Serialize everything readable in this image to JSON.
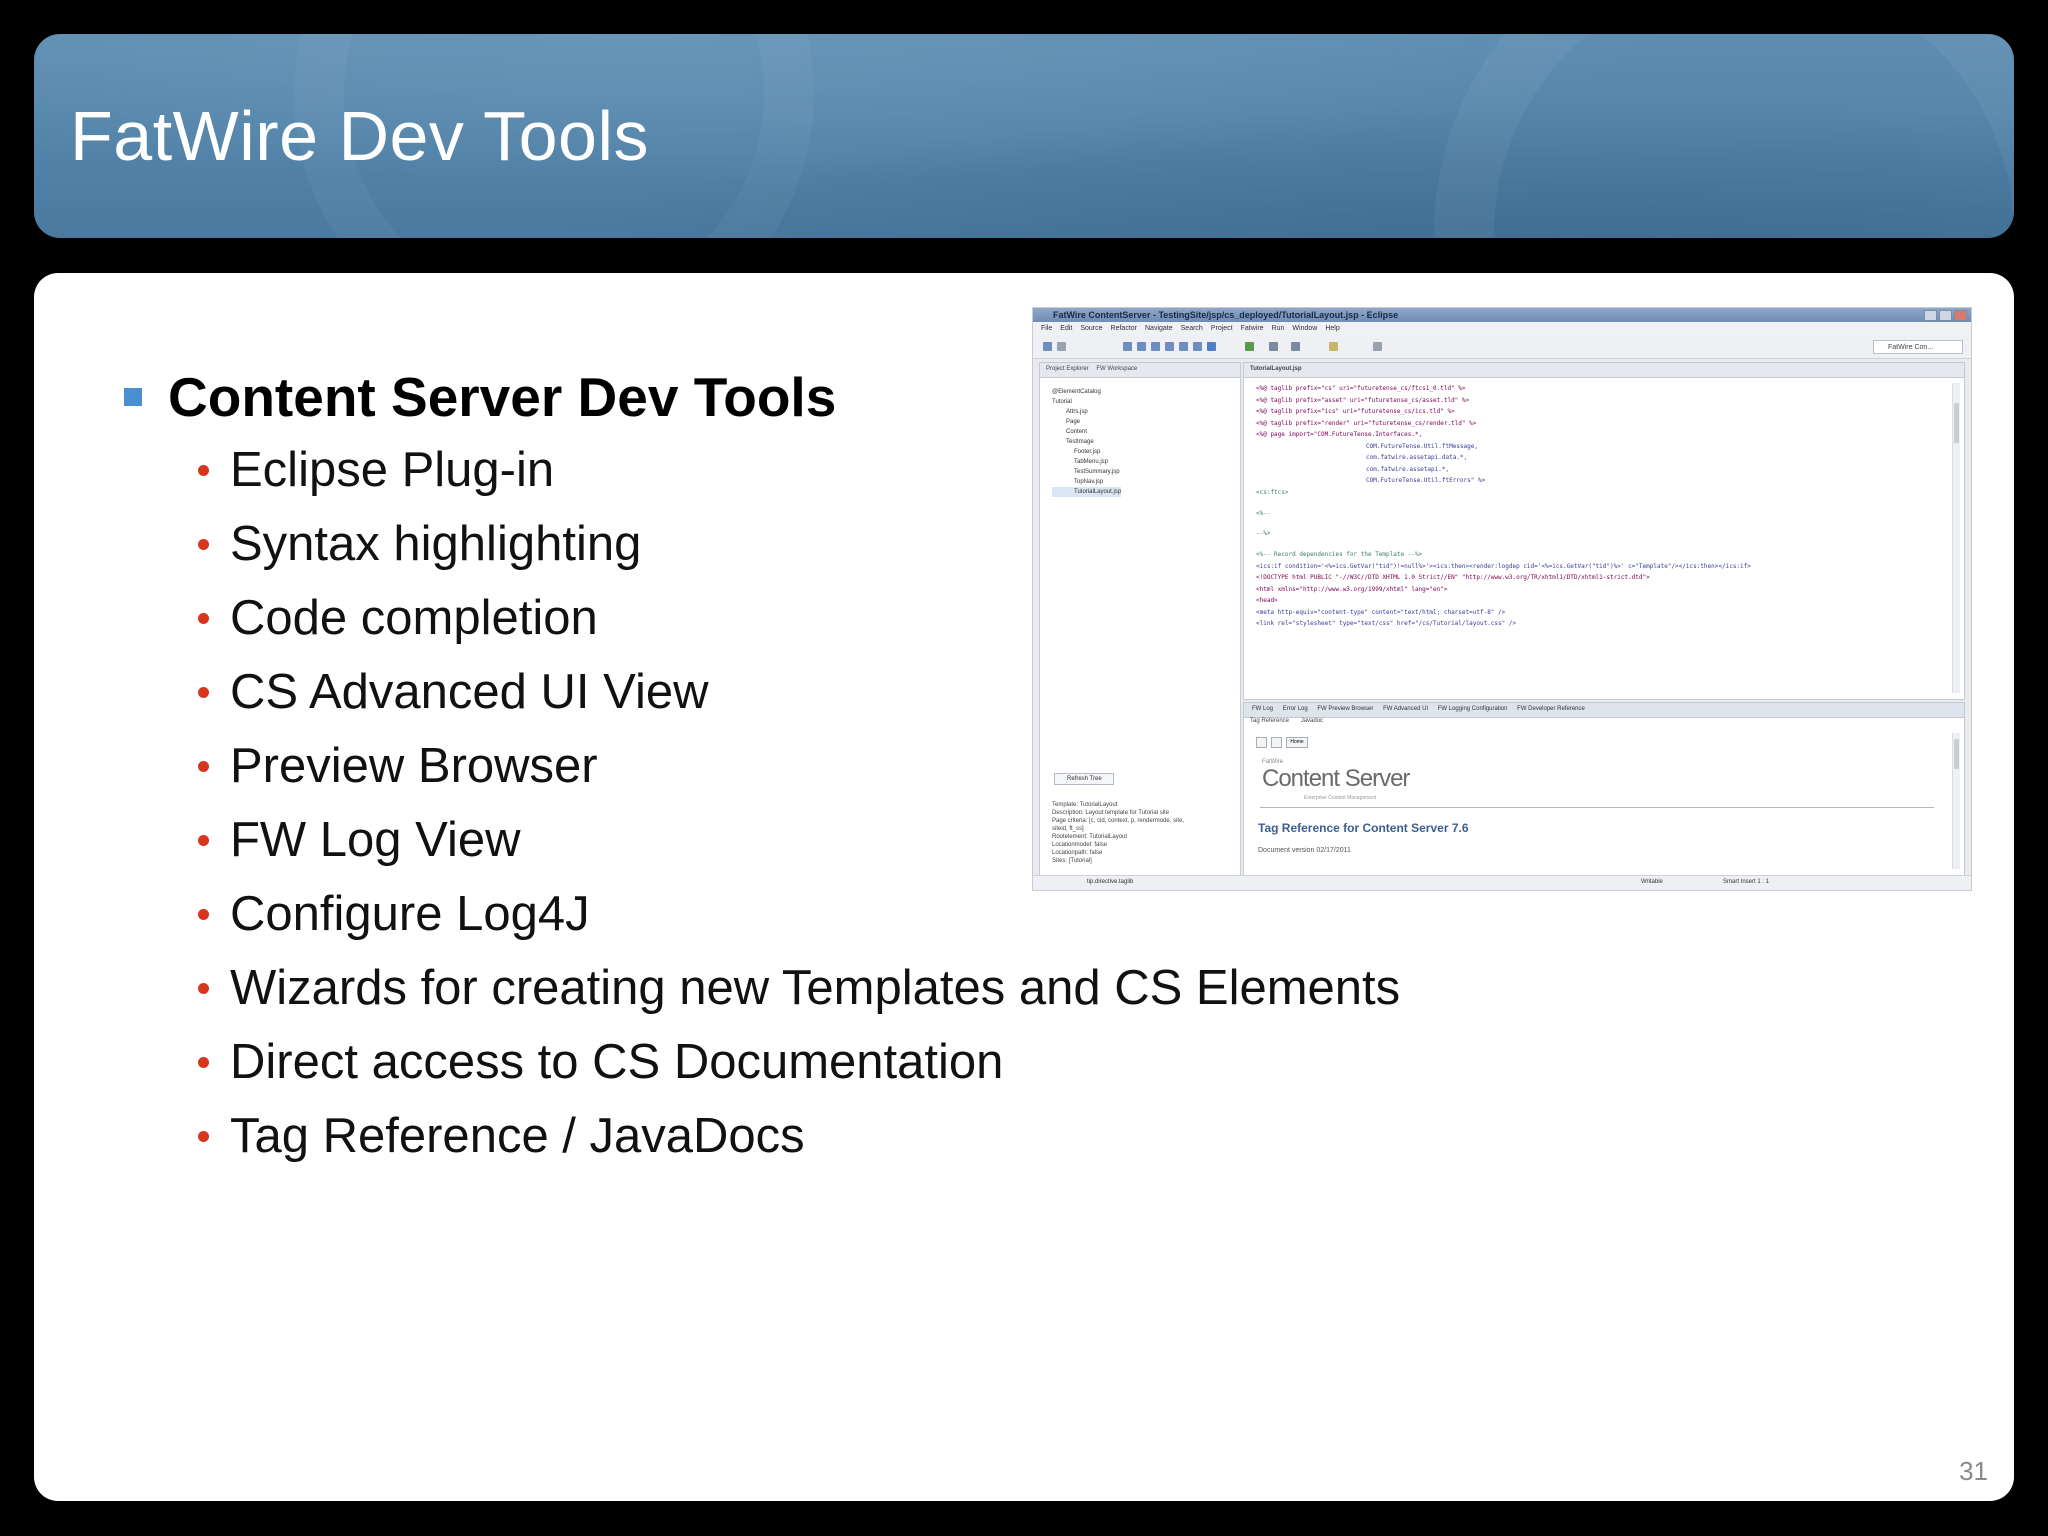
{
  "slide": {
    "title": "FatWire Dev Tools",
    "page_number": "31"
  },
  "content": {
    "heading": "Content Server Dev Tools",
    "items": [
      "Eclipse Plug-in",
      "Syntax highlighting",
      "Code completion",
      "CS Advanced UI View",
      "Preview Browser",
      "FW Log View",
      "Configure Log4J",
      "Wizards for creating new Templates and CS Elements",
      "Direct access to CS Documentation",
      "Tag Reference / JavaDocs"
    ]
  },
  "screenshot": {
    "window_title": "FatWire ContentServer - TestingSite/jsp/cs_deployed/TutorialLayout.jsp - Eclipse",
    "menu": [
      "File",
      "Edit",
      "Source",
      "Refactor",
      "Navigate",
      "Search",
      "Project",
      "Fatwire",
      "Run",
      "Window",
      "Help"
    ],
    "perspective": "FatWire Con...",
    "left_tabs": [
      "Project Explorer",
      "FW Workspace"
    ],
    "tree": [
      "@ElementCatalog",
      "Tutorial",
      "Attrs.jsp",
      "Page",
      "Content",
      "TestImage",
      "Footer.jsp",
      "TabMenu.jsp",
      "TestSummary.jsp",
      "TopNav.jsp",
      "TutorialLayout.jsp"
    ],
    "refresh_button": "Refresh Tree",
    "properties": [
      "Template: TutorialLayout",
      "Description: Layout template for Tutorial site",
      "Page criteria: [c, cid, context, p, rendermode, site,",
      "siteid, ft_ss]",
      "Rootelement: TutorialLayout",
      "Locationmodel: false",
      "Locationpath: false",
      "Sites: [Tutorial]"
    ],
    "editor_tab": "TutorialLayout.jsp",
    "code_lines": [
      "<%@ taglib prefix=\"cs\" uri=\"futuretense_cs/ftcs1_0.tld\" %>",
      "<%@ taglib prefix=\"asset\" uri=\"futuretense_cs/asset.tld\" %>",
      "<%@ taglib prefix=\"ics\" uri=\"futuretense_cs/ics.tld\" %>",
      "<%@ taglib prefix=\"render\" uri=\"futuretense_cs/render.tld\" %>",
      "<%@ page import=\"COM.FutureTense.Interfaces.*,",
      "COM.FutureTense.Util.ftMessage,",
      "com.fatwire.assetapi.data.*,",
      "com.fatwire.assetapi.*,",
      "COM.FutureTense.Util.ftErrors\" %>",
      "<cs:ftcs>",
      "<%-- ",
      "--%>",
      "<%-- Record dependencies for the Template --%>",
      "<ics:if condition='<%=ics.GetVar(\"tid\")!=null%>'><ics:then><render:logdep cid='<%=ics.GetVar(\"tid\")%>' c=\"Template\"/></ics:then></ics:if>",
      "<!DOCTYPE html PUBLIC \"-//W3C//DTD XHTML 1.0 Strict//EN\" \"http://www.w3.org/TR/xhtml1/DTD/xhtml1-strict.dtd\">",
      "<html xmlns=\"http://www.w3.org/1999/xhtml\" lang=\"en\">",
      "<head>",
      "<meta http-equiv=\"content-type\" content=\"text/html; charset=utf-8\" />",
      "<link rel=\"stylesheet\" type=\"text/css\" href=\"/cs/Tutorial/layout.css\" />"
    ],
    "bottom_tabs": [
      "FW Log",
      "Error Log",
      "FW Preview Browser",
      "FW Advanced UI",
      "FW Logging Configuration",
      "FW Developer Reference"
    ],
    "sub_tabs": [
      "Tag Reference",
      "Javadoc"
    ],
    "home_button": "Home",
    "brand_small": "FatWire",
    "brand": "Content Server",
    "brand_sub": "Enterprise Content Management",
    "tag_reference_title": "Tag Reference for Content Server 7.6",
    "doc_version": "Document version 02/17/2011",
    "status_left": "tip.directive.taglib",
    "status_mid": "Writable",
    "status_right": "Smart Insert    1 : 1"
  }
}
